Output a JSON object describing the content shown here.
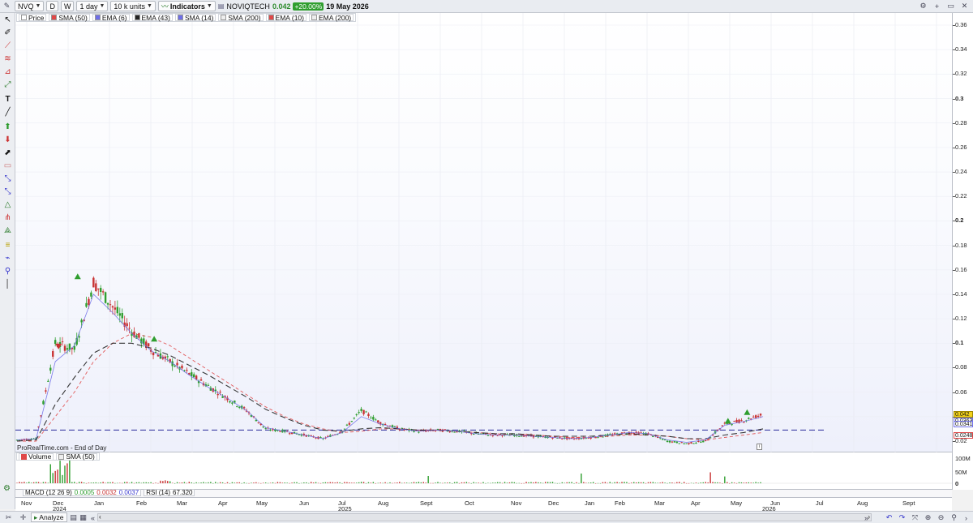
{
  "toolbar": {
    "symbol": "NVQ",
    "period_d": "D",
    "period_w": "W",
    "timeframe": "1 day",
    "units": "10 k units",
    "indicators_label": "Indicators",
    "instrument_name": "NOVIQTECH",
    "last_price": "0.042",
    "change_pct": "+20.00%",
    "date": "19 May 2026"
  },
  "legend": [
    {
      "label": "Price",
      "color": "#ffffff"
    },
    {
      "label": "SMA (50)",
      "color": "#e04848"
    },
    {
      "label": "EMA (6)",
      "color": "#6e6ee8"
    },
    {
      "label": "EMA (43)",
      "color": "#222222"
    },
    {
      "label": "SMA (14)",
      "color": "#6e6ee8"
    },
    {
      "label": "SMA (200)",
      "color": "#eeeeee"
    },
    {
      "label": "EMA (10)",
      "color": "#e04848"
    },
    {
      "label": "EMA (200)",
      "color": "#eeeeee"
    }
  ],
  "footer_note": "ProRealTime.com - End of Day",
  "info_icon": "i",
  "volume_legend": [
    "Volume",
    "SMA (50)"
  ],
  "volume_axis": [
    "100M",
    "50M",
    "0"
  ],
  "indicator_strip": {
    "macd_label": "MACD (12 26 9)",
    "macd_v1": "0.0005",
    "macd_v2": "0.0032",
    "macd_v3": "0.0037",
    "rsi_label": "RSI (14)",
    "rsi_value": "67.320"
  },
  "analyze_label": "Analyze",
  "price_axis_labels": {
    "last": "0.042",
    "l2": "0.0363",
    "l3": "0.0341",
    "l4": "0.0248"
  },
  "colors": {
    "up": "#2f9e2f",
    "down": "#c83232",
    "sma50": "#e04848",
    "ema43": "#222222",
    "ema6": "#6e6ee8",
    "hline": "#2a2a9a",
    "vol_up": "#2f9e2f",
    "vol_down": "#c83232"
  },
  "chart_data": {
    "type": "line",
    "title": "NOVIQTECH",
    "ylim": [
      0,
      0.37
    ],
    "yticks": [
      "0.36",
      "0.34",
      "0.32",
      "0.3",
      "0.28",
      "0.26",
      "0.24",
      "0.22",
      "0.2",
      "0.18",
      "0.16",
      "0.14",
      "0.12",
      "0.1",
      "0.08",
      "0.06",
      "0.04",
      "0.02"
    ],
    "y_values": [
      0.36,
      0.34,
      0.32,
      0.3,
      0.28,
      0.26,
      0.24,
      0.22,
      0.2,
      0.18,
      0.16,
      0.14,
      0.12,
      0.1,
      0.08,
      0.06,
      0.04,
      0.02
    ],
    "x_months": [
      "Nov",
      "Dec",
      "Jan",
      "Feb",
      "Mar",
      "Apr",
      "May",
      "Jun",
      "Jul",
      "Aug",
      "Sept",
      "Oct",
      "Nov",
      "Dec",
      "Jan",
      "Feb",
      "Mar",
      "Apr",
      "May",
      "Jun",
      "Jul",
      "Aug",
      "Sept"
    ],
    "x_years": [
      "2024",
      "2025",
      "2026"
    ],
    "reference_line": 0.029,
    "series": [
      {
        "name": "Price",
        "values": [
          0.021,
          0.022,
          0.1,
          0.095,
          0.15,
          0.13,
          0.11,
          0.095,
          0.085,
          0.075,
          0.065,
          0.055,
          0.045,
          0.03,
          0.028,
          0.025,
          0.022,
          0.028,
          0.045,
          0.035,
          0.03,
          0.028,
          0.029,
          0.028,
          0.026,
          0.025,
          0.025,
          0.024,
          0.023,
          0.022,
          0.023,
          0.025,
          0.027,
          0.026,
          0.02,
          0.018,
          0.02,
          0.034,
          0.037,
          0.042
        ]
      },
      {
        "name": "SMA (50)",
        "values": [
          0.02,
          0.02,
          0.04,
          0.06,
          0.085,
          0.1,
          0.108,
          0.105,
          0.098,
          0.088,
          0.078,
          0.068,
          0.058,
          0.048,
          0.04,
          0.034,
          0.03,
          0.027,
          0.028,
          0.03,
          0.03,
          0.029,
          0.029,
          0.028,
          0.027,
          0.026,
          0.025,
          0.025,
          0.024,
          0.023,
          0.023,
          0.024,
          0.025,
          0.025,
          0.024,
          0.022,
          0.021,
          0.023,
          0.025,
          0.027
        ]
      },
      {
        "name": "EMA (43)",
        "values": [
          0.02,
          0.021,
          0.05,
          0.072,
          0.092,
          0.1,
          0.1,
          0.096,
          0.09,
          0.082,
          0.074,
          0.065,
          0.056,
          0.046,
          0.039,
          0.033,
          0.029,
          0.028,
          0.03,
          0.031,
          0.03,
          0.029,
          0.029,
          0.028,
          0.027,
          0.026,
          0.026,
          0.025,
          0.024,
          0.024,
          0.024,
          0.025,
          0.026,
          0.025,
          0.024,
          0.022,
          0.022,
          0.025,
          0.027,
          0.03
        ]
      },
      {
        "name": "EMA (6)",
        "values": [
          0.021,
          0.022,
          0.085,
          0.098,
          0.14,
          0.125,
          0.108,
          0.094,
          0.085,
          0.074,
          0.064,
          0.055,
          0.045,
          0.031,
          0.028,
          0.025,
          0.022,
          0.027,
          0.04,
          0.034,
          0.03,
          0.028,
          0.029,
          0.028,
          0.026,
          0.025,
          0.025,
          0.024,
          0.023,
          0.022,
          0.023,
          0.025,
          0.027,
          0.026,
          0.021,
          0.019,
          0.021,
          0.033,
          0.036,
          0.04
        ]
      }
    ]
  }
}
